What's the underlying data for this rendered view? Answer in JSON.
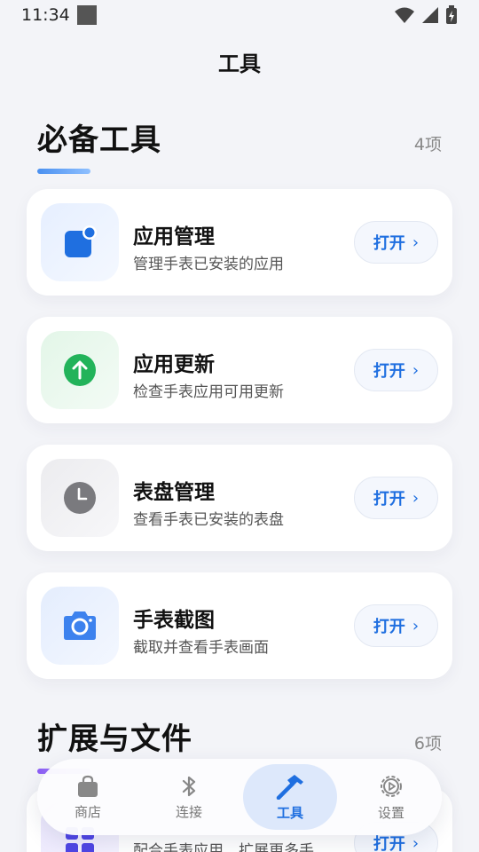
{
  "status_bar": {
    "time": "11:34"
  },
  "header": {
    "title": "工具"
  },
  "sections": [
    {
      "title": "必备工具",
      "count": "4项",
      "accent_color": "#4a90f0",
      "items": [
        {
          "title": "应用管理",
          "desc": "管理手表已安装的应用",
          "action": "打开",
          "icon": "app-badge-icon",
          "color": "#1f6fe0"
        },
        {
          "title": "应用更新",
          "desc": "检查手表应用可用更新",
          "action": "打开",
          "icon": "arrow-up-circle-icon",
          "color": "#22b35a"
        },
        {
          "title": "表盘管理",
          "desc": "查看手表已安装的表盘",
          "action": "打开",
          "icon": "clock-icon",
          "color": "#777777"
        },
        {
          "title": "手表截图",
          "desc": "截取并查看手表画面",
          "action": "打开",
          "icon": "camera-icon",
          "color": "#3d82ee"
        }
      ]
    },
    {
      "title": "扩展与文件",
      "count": "6项",
      "accent_color": "#8b5cf6",
      "items": [
        {
          "title": "",
          "desc": "配合手表应用，扩展更多手",
          "action": "打开",
          "icon": "grid-icon",
          "color": "#4f46e5"
        }
      ]
    }
  ],
  "bottom_nav": [
    {
      "label": "商店",
      "icon": "shopping-bag-icon",
      "active": false
    },
    {
      "label": "连接",
      "icon": "bluetooth-icon",
      "active": false
    },
    {
      "label": "工具",
      "icon": "hammer-icon",
      "active": true
    },
    {
      "label": "设置",
      "icon": "settings-icon",
      "active": false
    }
  ],
  "colors": {
    "accent": "#1f6fe0",
    "background": "#f3f4f8"
  }
}
